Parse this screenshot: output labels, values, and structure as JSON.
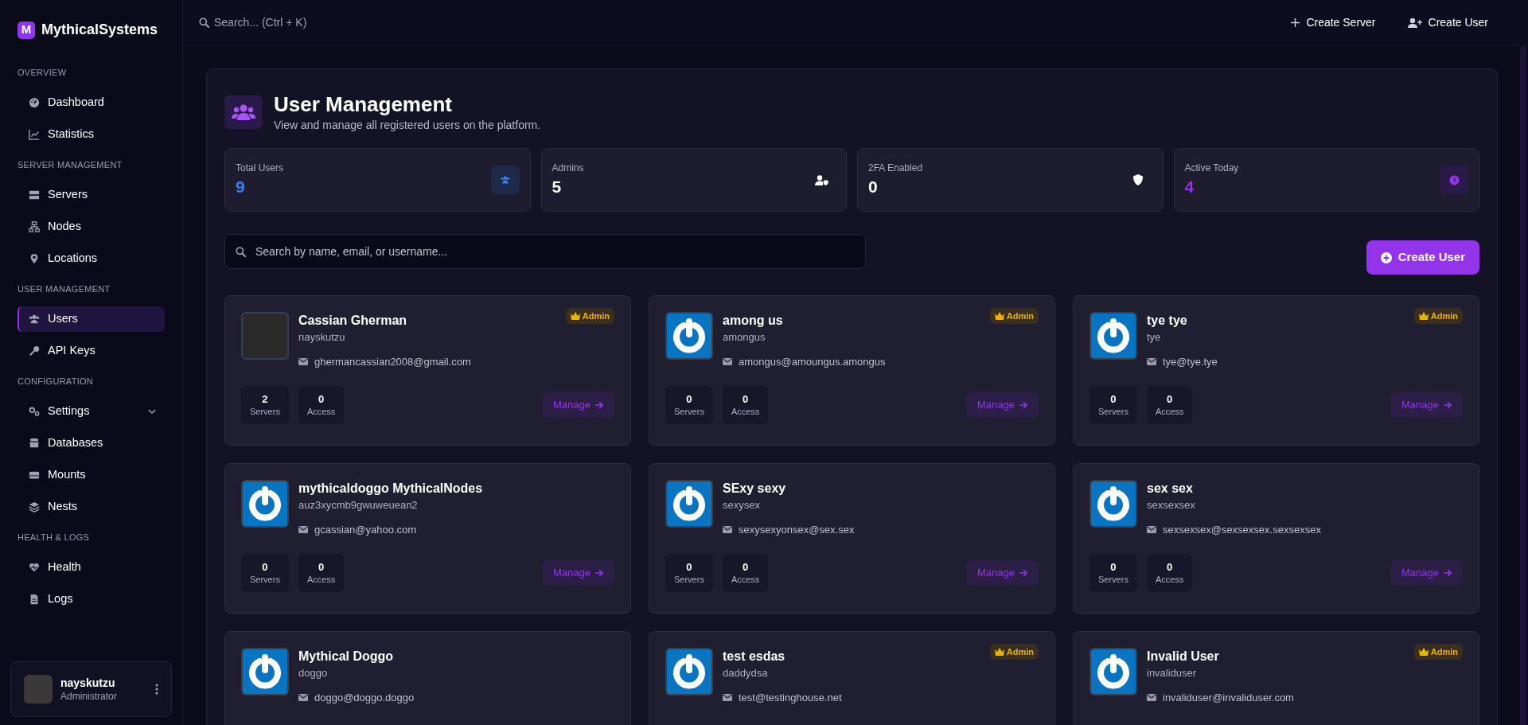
{
  "brand": {
    "logo_letter": "M",
    "name": "MythicalSystems"
  },
  "sidebar": {
    "sections": [
      {
        "title": "OVERVIEW",
        "items": [
          {
            "label": "Dashboard",
            "kind": "gauge",
            "selected": false
          },
          {
            "label": "Statistics",
            "kind": "chart",
            "selected": false
          }
        ]
      },
      {
        "title": "SERVER MANAGEMENT",
        "items": [
          {
            "label": "Servers",
            "kind": "server",
            "selected": false
          },
          {
            "label": "Nodes",
            "kind": "network",
            "selected": false
          },
          {
            "label": "Locations",
            "kind": "pin",
            "selected": false
          }
        ]
      },
      {
        "title": "USER MANAGEMENT",
        "items": [
          {
            "label": "Users",
            "kind": "users",
            "selected": true
          },
          {
            "label": "API Keys",
            "kind": "key",
            "selected": false
          }
        ]
      },
      {
        "title": "CONFIGURATION",
        "items": [
          {
            "label": "Settings",
            "kind": "cogs",
            "selected": false,
            "expanded": false
          },
          {
            "label": "Databases",
            "kind": "database",
            "selected": false
          },
          {
            "label": "Mounts",
            "kind": "hdd",
            "selected": false
          },
          {
            "label": "Nests",
            "kind": "layers",
            "selected": false
          }
        ]
      },
      {
        "title": "HEALTH & LOGS",
        "items": [
          {
            "label": "Health",
            "kind": "heart",
            "selected": false
          },
          {
            "label": "Logs",
            "kind": "file",
            "selected": false
          }
        ]
      }
    ],
    "profile": {
      "name": "nayskutzu",
      "role": "Administrator"
    }
  },
  "topbar": {
    "search_placeholder": "Search... (Ctrl + K)",
    "actions": [
      {
        "label": "Create Server",
        "kind": "plus"
      },
      {
        "label": "Create User",
        "kind": "user-plus"
      }
    ]
  },
  "page": {
    "title": "User Management",
    "subtitle": "View and manage all registered users on the platform.",
    "stats": [
      {
        "label": "Total Users",
        "value": "9",
        "kind": "users",
        "color": "#3b82f6"
      },
      {
        "label": "Admins",
        "value": "5",
        "kind": "user-shield",
        "color": "#ffffff"
      },
      {
        "label": "2FA Enabled",
        "value": "0",
        "kind": "shield",
        "color": "#ffffff"
      },
      {
        "label": "Active Today",
        "value": "4",
        "kind": "clock",
        "color": "#9333ea"
      }
    ],
    "search_placeholder": "Search by name, email, or username...",
    "create_button": "Create User",
    "users": [
      {
        "name": "Cassian Gherman",
        "username": "nayskutzu",
        "email": "ghermancassian2008@gmail.com",
        "kind": "photo",
        "admin_badge": "Admin",
        "servers": "2",
        "servers_label": "Servers",
        "access": "0",
        "access_label": "Access",
        "manage": "Manage"
      },
      {
        "name": "among us",
        "username": "amongus",
        "email": "amongus@amoungus.amongus",
        "kind": "default",
        "admin_badge": "Admin",
        "servers": "0",
        "servers_label": "Servers",
        "access": "0",
        "access_label": "Access",
        "manage": "Manage"
      },
      {
        "name": "tye tye",
        "username": "tye",
        "email": "tye@tye.tye",
        "kind": "default",
        "admin_badge": "Admin",
        "servers": "0",
        "servers_label": "Servers",
        "access": "0",
        "access_label": "Access",
        "manage": "Manage"
      },
      {
        "name": "mythicaldoggo MythicalNodes",
        "username": "auz3xycmb9gwuweuean2",
        "email": "gcassian@yahoo.com",
        "kind": "default",
        "servers": "0",
        "servers_label": "Servers",
        "access": "0",
        "access_label": "Access",
        "manage": "Manage"
      },
      {
        "name": "SExy sexy",
        "username": "sexysex",
        "email": "sexysexyonsex@sex.sex",
        "kind": "default",
        "servers": "0",
        "servers_label": "Servers",
        "access": "0",
        "access_label": "Access",
        "manage": "Manage"
      },
      {
        "name": "sex sex",
        "username": "sexsexsex",
        "email": "sexsexsex@sexsexsex.sexsexsex",
        "kind": "default",
        "servers": "0",
        "servers_label": "Servers",
        "access": "0",
        "access_label": "Access",
        "manage": "Manage"
      },
      {
        "name": "Mythical Doggo",
        "username": "doggo",
        "email": "doggo@doggo.doggo",
        "kind": "default"
      },
      {
        "name": "test esdas",
        "username": "daddydsa",
        "email": "test@testinghouse.net",
        "kind": "default",
        "admin_badge": "Admin"
      },
      {
        "name": "Invalid User",
        "username": "invaliduser",
        "email": "invaliduser@invaliduser.com",
        "kind": "default",
        "admin_badge": "Admin"
      }
    ]
  }
}
